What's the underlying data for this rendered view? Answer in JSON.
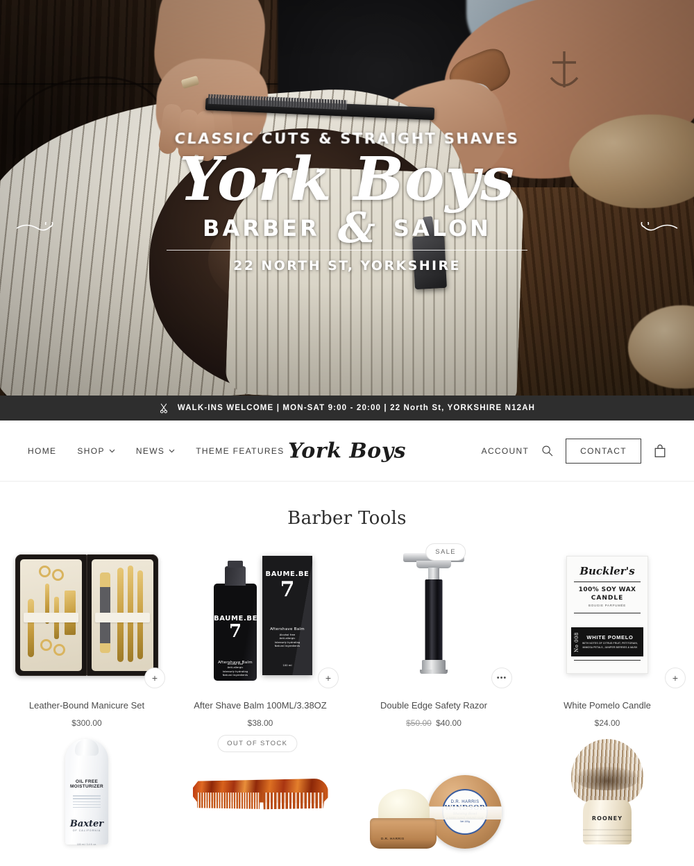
{
  "announcement": {
    "icon": "scissors-icon",
    "text": "WALK-INS WELCOME | MON-SAT 9:00 - 20:00 | 22 North St, YORKSHIRE N12AH",
    "background": "#2e2e2e",
    "text_color": "#ffffff"
  },
  "hero": {
    "overlay": {
      "tagline": "CLASSIC CUTS & STRAIGHT SHAVES",
      "logo": "York Boys",
      "service_left": "BARBER",
      "ampersand": "&",
      "service_right": "SALON",
      "address": "22 NORTH ST, YORKSHIRE"
    },
    "image_description": "barber-cutting-hair-photo"
  },
  "header": {
    "brand": "York Boys",
    "nav": [
      {
        "label": "HOME",
        "has_dropdown": false
      },
      {
        "label": "SHOP",
        "has_dropdown": true
      },
      {
        "label": "NEWS",
        "has_dropdown": true
      },
      {
        "label": "THEME FEATURES",
        "has_dropdown": false
      }
    ],
    "account_label": "ACCOUNT",
    "search_icon": "search-icon",
    "contact_label": "CONTACT",
    "cart_icon": "shopping-bag-icon"
  },
  "collection": {
    "title": "Barber Tools",
    "products": [
      {
        "title": "Leather-Bound Manicure Set",
        "price": "$300.00",
        "compare_price": "",
        "badge": "",
        "quick_add": "+",
        "art": "manicure-set"
      },
      {
        "title": "After Shave Balm 100ML/3.38OZ",
        "price": "$38.00",
        "compare_price": "",
        "badge": "",
        "quick_add": "+",
        "art": "baume-be-balm",
        "label": {
          "brand": "BAUME.BE",
          "product": "Aftershave Balm",
          "claims": "Alcohol free\nAnti-allergic\nIntensely hydrating\nNatural ingredients",
          "volume": "100 ml"
        }
      },
      {
        "title": "Double Edge Safety Razor",
        "price": "$40.00",
        "compare_price": "$50.00",
        "badge": "SALE",
        "quick_add": "•••",
        "art": "safety-razor"
      },
      {
        "title": "White Pomelo Candle",
        "price": "$24.00",
        "compare_price": "",
        "badge": "",
        "quick_add": "+",
        "art": "candle-box",
        "label": {
          "brand": "Buckler's",
          "line1": "100% SOY WAX",
          "line2": "CANDLE",
          "line3": "BOUGIE PARFUMÉE",
          "number": "No 008",
          "scent": "WHITE POMELO",
          "notes": "WITH NOTES OF CITRUS FRUIT, PETITGRAIN, MIMOSA PETALS, JUNIPER BERRIES & MUSK"
        }
      },
      {
        "title": "",
        "price": "",
        "compare_price": "",
        "badge": "",
        "quick_add": "",
        "art": "moisturizer-tube",
        "label": {
          "line1": "OIL FREE",
          "line2": "MOISTURIZER",
          "brand": "Baxter",
          "sub": "OF CALIFORNIA",
          "volume": "100 ml / 3.4 fl. oz."
        }
      },
      {
        "title": "",
        "price": "",
        "compare_price": "",
        "badge": "OUT OF STOCK",
        "quick_add": "",
        "art": "tortoise-comb"
      },
      {
        "title": "",
        "price": "",
        "compare_price": "",
        "badge": "",
        "quick_add": "",
        "art": "shaving-bowls",
        "label": {
          "brand": "D.R. HARRIS",
          "main": "WINDSOR",
          "sub": "Shaving Bowl",
          "tiny": "A THREE OUNCE SHAVING SOAP",
          "weight": "Net 100g"
        }
      },
      {
        "title": "",
        "price": "",
        "compare_price": "",
        "badge": "",
        "quick_add": "",
        "art": "shaving-brush",
        "label": {
          "brand": "ROONEY"
        }
      }
    ]
  }
}
